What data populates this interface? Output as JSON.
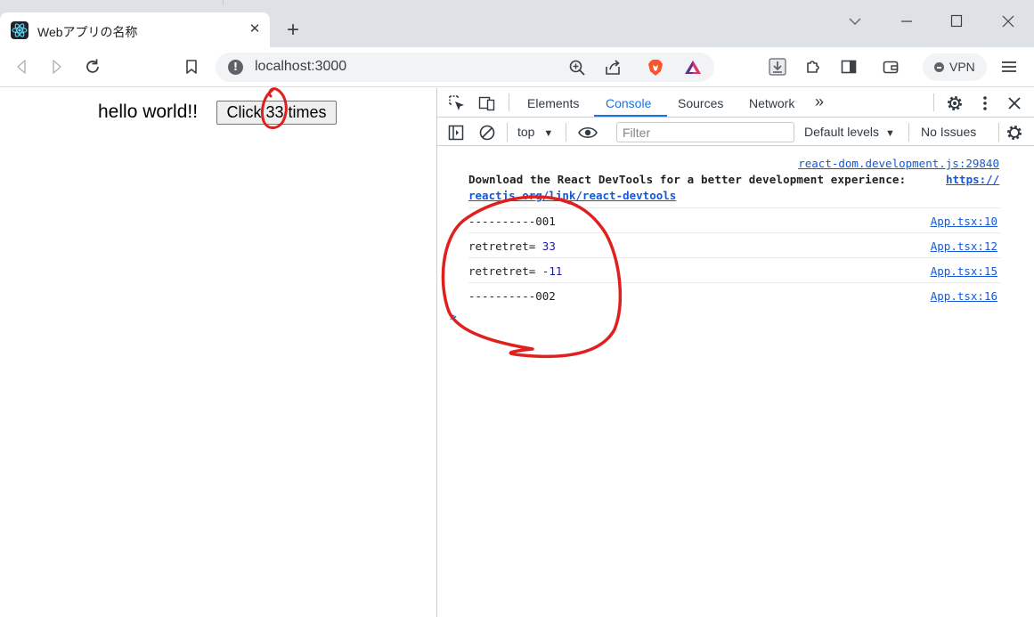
{
  "browser": {
    "tab": {
      "title": "Webアプリの名称",
      "favicon": "react-logo-icon"
    },
    "new_tab_symbol": "+",
    "tab_close_symbol": "✕",
    "address": {
      "url": "localhost:3000"
    },
    "vpn_label": "VPN"
  },
  "page": {
    "text": "hello world!!",
    "button_label": "Click 33 times"
  },
  "devtools": {
    "tabs": [
      "Elements",
      "Console",
      "Sources",
      "Network"
    ],
    "active_tab": "Console",
    "more_tabs_symbol": "»",
    "context": "top",
    "filter_placeholder": "Filter",
    "levels_label": "Default levels",
    "issues_label": "No Issues",
    "console": {
      "intro_source": "react-dom.development.js:29840",
      "intro_text": "Download the React DevTools for a better development experience: ",
      "intro_link_part1": "https://",
      "intro_link_part2": "reactjs.org/link/react-devtools",
      "messages": [
        {
          "text": "----------001",
          "value": "",
          "source": "App.tsx:10"
        },
        {
          "text": "retretret= ",
          "value": "33",
          "source": "App.tsx:12"
        },
        {
          "text": "retretret= ",
          "value": "-11",
          "source": "App.tsx:15"
        },
        {
          "text": "----------002",
          "value": "",
          "source": "App.tsx:16"
        }
      ],
      "prompt_symbol": ">"
    }
  },
  "colors": {
    "accent": "#1a73e8",
    "annotation": "#e0201e",
    "link": "#1558d6",
    "number": "#1a1aa6"
  }
}
